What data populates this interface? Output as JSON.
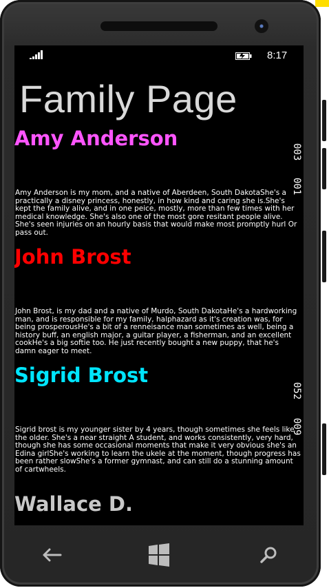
{
  "status_bar": {
    "time": "8:17"
  },
  "page": {
    "title": "Family Page"
  },
  "members": [
    {
      "name": "Amy Anderson",
      "color": "#ff55ff",
      "bio": "Amy Anderson is my mom, and a native of Aberdeen, South DakotaShe's a practically a disney princess, honestly, in how kind and caring she is.She's kept the family alive, and in one peice, mostly, more than few times with her medical knowledge. She's also one of the most gore resitant people alive. She's seen injuries on an hourly basis that would make most promptly hurl Or pass out."
    },
    {
      "name": "John Brost",
      "color": "#ff0000",
      "bio": "John Brost, is my dad and a native of Murdo, South DakotaHe's a hardworking man, and is responsible for my family, halphazard as it's creation was, for being prosperousHe's a bit of a renneisance man sometimes as well, being a history buff, an english major, a guitar player, a fisherman, and an excellent cookHe's a big softie too. He just recently bought a new puppy, that he's damn eager to meet."
    },
    {
      "name": "Sigrid Brost",
      "color": "#00e5ff",
      "bio": "Sigrid brost is my younger sister by 4 years, though sometimes she feels like the older. She's a near straight A student, and works consistently, very hard, though she has some occasional moments that make it very obvious she's an Edina girlShe's working to learn the ukele at the moment, though progress has been rather slowShe's a former gymnast, and can still do a stunning amount of cartwheels."
    },
    {
      "name": "Wallace D.",
      "color": "#c8c8c8",
      "bio": ""
    }
  ],
  "counters": [
    "003",
    "001",
    "052",
    "009"
  ],
  "nav": {
    "back_icon": "back-arrow-icon",
    "start_icon": "windows-start-icon",
    "search_icon": "search-icon"
  }
}
